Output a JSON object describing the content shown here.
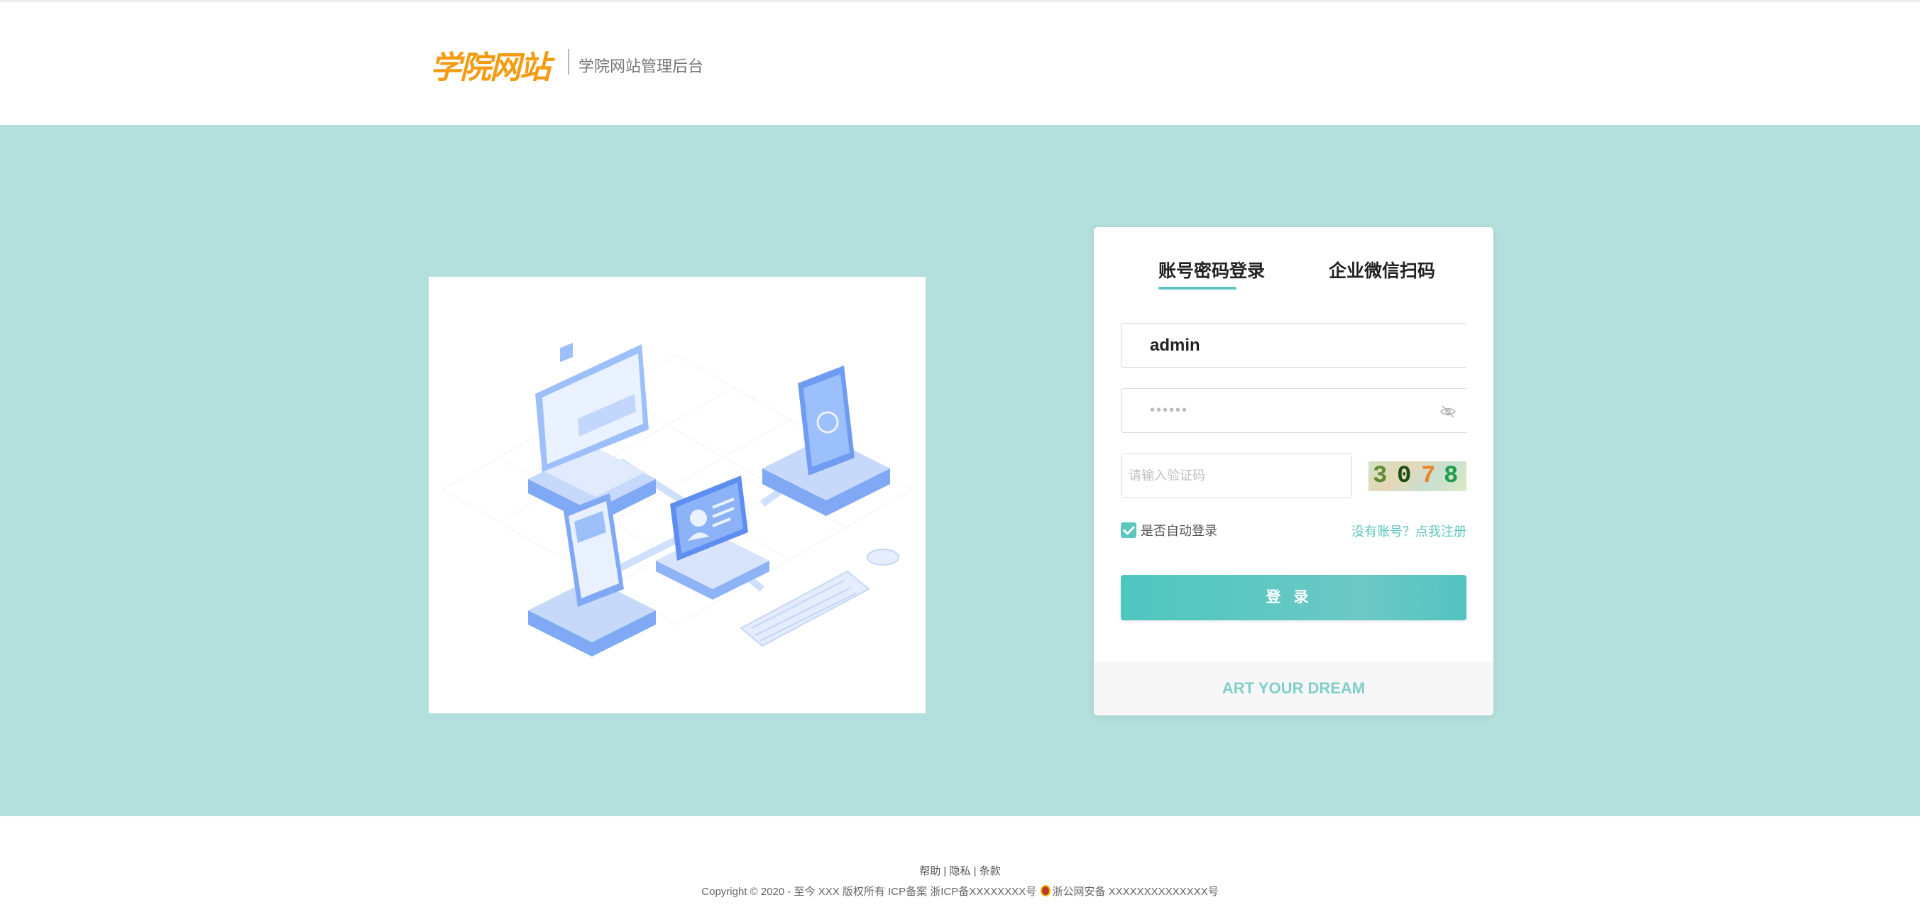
{
  "header": {
    "logo_text": "学院网站",
    "subtitle": "学院网站管理后台"
  },
  "login": {
    "tabs": [
      {
        "label": "账号密码登录",
        "active": true
      },
      {
        "label": "企业微信扫码",
        "active": false
      }
    ],
    "username_value": "admin",
    "password_mask": "••••••",
    "captcha_placeholder": "请输入验证码",
    "captcha_chars": [
      "3",
      "0",
      "7",
      "8"
    ],
    "captcha_colors": [
      "#5f8a2e",
      "#1a4f14",
      "#e8842a",
      "#1e9e4a"
    ],
    "remember_label": "是否自动登录",
    "remember_checked": true,
    "register_link": "没有账号？点我注册",
    "submit_label": "登录",
    "slogan": "ART YOUR DREAM"
  },
  "footer": {
    "links": [
      "帮助",
      "隐私",
      "条款"
    ],
    "copyright": "Copyright © 2020 - 至今 XXX 版权所有 ICP备案 浙ICP备XXXXXXXX号",
    "police_record": "浙公网安备 XXXXXXXXXXXXXX号"
  },
  "colors": {
    "accent": "#5cc6bf",
    "band": "#b3e0dc",
    "logo": "#f39c12"
  }
}
